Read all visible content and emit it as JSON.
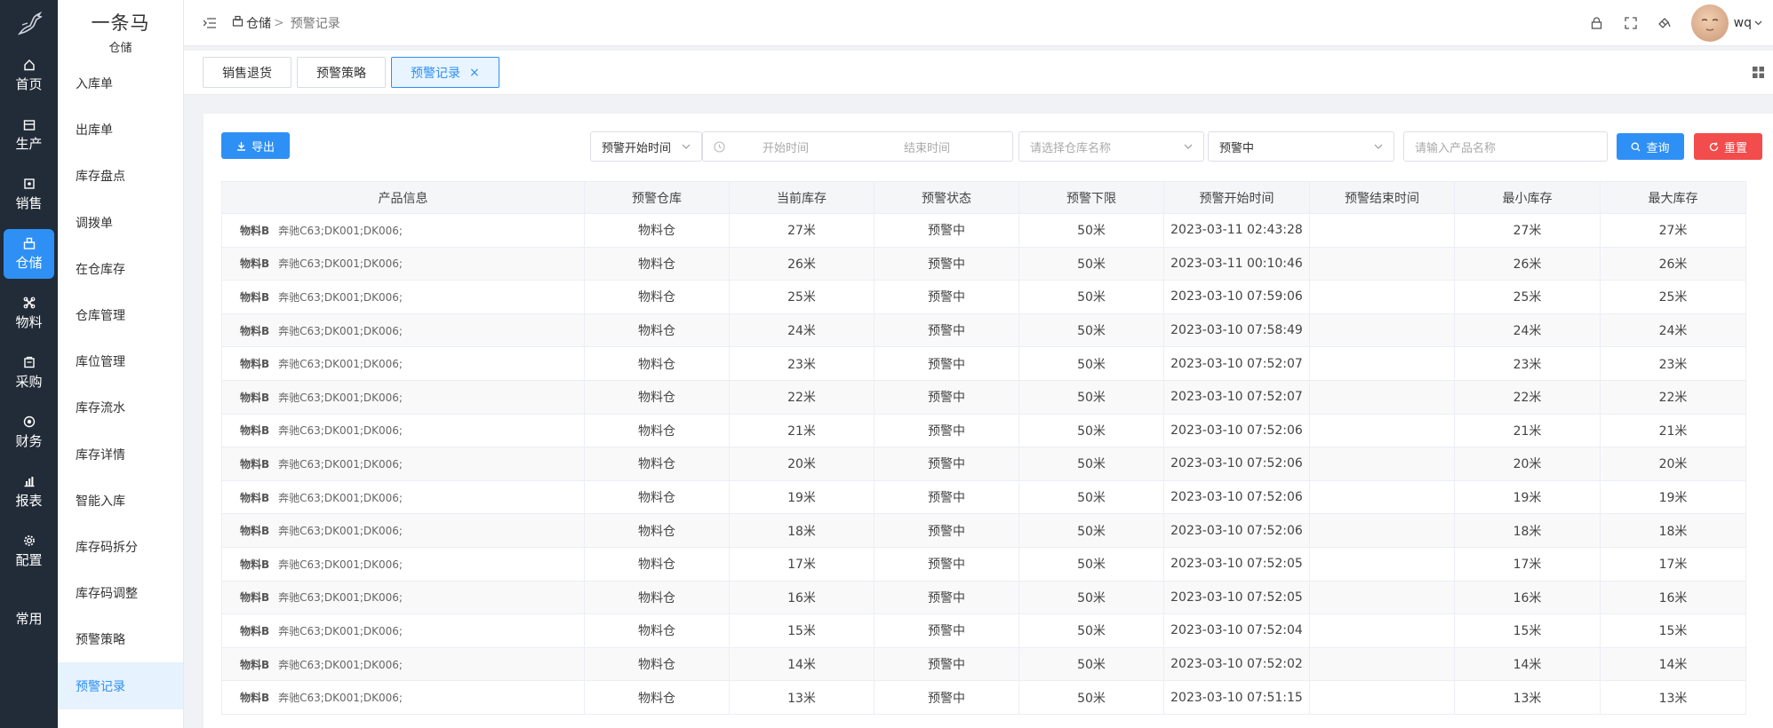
{
  "rail": {
    "items": [
      {
        "label": "首页",
        "icon": "home-icon"
      },
      {
        "label": "生产",
        "icon": "production-icon"
      },
      {
        "label": "销售",
        "icon": "sales-icon"
      },
      {
        "label": "仓储",
        "icon": "warehouse-icon",
        "active": true
      },
      {
        "label": "物料",
        "icon": "material-icon"
      },
      {
        "label": "采购",
        "icon": "purchase-icon"
      },
      {
        "label": "财务",
        "icon": "finance-icon"
      },
      {
        "label": "报表",
        "icon": "report-icon"
      },
      {
        "label": "配置",
        "icon": "gear-icon"
      },
      {
        "label": "常用",
        "icon": ""
      }
    ]
  },
  "brand": {
    "name": "一条马",
    "section": "仓储"
  },
  "sidebar": {
    "items": [
      {
        "label": "入库单"
      },
      {
        "label": "出库单"
      },
      {
        "label": "库存盘点"
      },
      {
        "label": "调拨单"
      },
      {
        "label": "在仓库存"
      },
      {
        "label": "仓库管理"
      },
      {
        "label": "库位管理"
      },
      {
        "label": "库存流水"
      },
      {
        "label": "库存详情"
      },
      {
        "label": "智能入库"
      },
      {
        "label": "库存码拆分"
      },
      {
        "label": "库存码调整"
      },
      {
        "label": "预警策略"
      },
      {
        "label": "预警记录",
        "active": true
      }
    ]
  },
  "header": {
    "breadcrumb_root": "仓储",
    "breadcrumb_sep": ">",
    "breadcrumb_current": "预警记录",
    "username": "wq"
  },
  "tabs": [
    {
      "label": "销售退货"
    },
    {
      "label": "预警策略"
    },
    {
      "label": "预警记录",
      "active": true,
      "close": "×"
    }
  ],
  "toolbar": {
    "export_label": "导出",
    "time_type": "预警开始时间",
    "start_placeholder": "开始时间",
    "end_placeholder": "结束时间",
    "warehouse_placeholder": "请选择仓库名称",
    "status_value": "预警中",
    "product_placeholder": "请输入产品名称",
    "query_label": "查询",
    "reset_label": "重置"
  },
  "table": {
    "columns": [
      "产品信息",
      "预警仓库",
      "当前库存",
      "预警状态",
      "预警下限",
      "预警开始时间",
      "预警结束时间",
      "最小库存",
      "最大库存"
    ],
    "rows": [
      {
        "name": "物料B",
        "spec": "奔驰C63;DK001;DK006;",
        "warehouse": "物料仓",
        "current": "27米",
        "status": "预警中",
        "lower": "50米",
        "start": "2023-03-11 02:43:28",
        "end": "",
        "min": "27米",
        "max": "27米"
      },
      {
        "name": "物料B",
        "spec": "奔驰C63;DK001;DK006;",
        "warehouse": "物料仓",
        "current": "26米",
        "status": "预警中",
        "lower": "50米",
        "start": "2023-03-11 00:10:46",
        "end": "",
        "min": "26米",
        "max": "26米"
      },
      {
        "name": "物料B",
        "spec": "奔驰C63;DK001;DK006;",
        "warehouse": "物料仓",
        "current": "25米",
        "status": "预警中",
        "lower": "50米",
        "start": "2023-03-10 07:59:06",
        "end": "",
        "min": "25米",
        "max": "25米"
      },
      {
        "name": "物料B",
        "spec": "奔驰C63;DK001;DK006;",
        "warehouse": "物料仓",
        "current": "24米",
        "status": "预警中",
        "lower": "50米",
        "start": "2023-03-10 07:58:49",
        "end": "",
        "min": "24米",
        "max": "24米"
      },
      {
        "name": "物料B",
        "spec": "奔驰C63;DK001;DK006;",
        "warehouse": "物料仓",
        "current": "23米",
        "status": "预警中",
        "lower": "50米",
        "start": "2023-03-10 07:52:07",
        "end": "",
        "min": "23米",
        "max": "23米"
      },
      {
        "name": "物料B",
        "spec": "奔驰C63;DK001;DK006;",
        "warehouse": "物料仓",
        "current": "22米",
        "status": "预警中",
        "lower": "50米",
        "start": "2023-03-10 07:52:07",
        "end": "",
        "min": "22米",
        "max": "22米"
      },
      {
        "name": "物料B",
        "spec": "奔驰C63;DK001;DK006;",
        "warehouse": "物料仓",
        "current": "21米",
        "status": "预警中",
        "lower": "50米",
        "start": "2023-03-10 07:52:06",
        "end": "",
        "min": "21米",
        "max": "21米"
      },
      {
        "name": "物料B",
        "spec": "奔驰C63;DK001;DK006;",
        "warehouse": "物料仓",
        "current": "20米",
        "status": "预警中",
        "lower": "50米",
        "start": "2023-03-10 07:52:06",
        "end": "",
        "min": "20米",
        "max": "20米"
      },
      {
        "name": "物料B",
        "spec": "奔驰C63;DK001;DK006;",
        "warehouse": "物料仓",
        "current": "19米",
        "status": "预警中",
        "lower": "50米",
        "start": "2023-03-10 07:52:06",
        "end": "",
        "min": "19米",
        "max": "19米"
      },
      {
        "name": "物料B",
        "spec": "奔驰C63;DK001;DK006;",
        "warehouse": "物料仓",
        "current": "18米",
        "status": "预警中",
        "lower": "50米",
        "start": "2023-03-10 07:52:06",
        "end": "",
        "min": "18米",
        "max": "18米"
      },
      {
        "name": "物料B",
        "spec": "奔驰C63;DK001;DK006;",
        "warehouse": "物料仓",
        "current": "17米",
        "status": "预警中",
        "lower": "50米",
        "start": "2023-03-10 07:52:05",
        "end": "",
        "min": "17米",
        "max": "17米"
      },
      {
        "name": "物料B",
        "spec": "奔驰C63;DK001;DK006;",
        "warehouse": "物料仓",
        "current": "16米",
        "status": "预警中",
        "lower": "50米",
        "start": "2023-03-10 07:52:05",
        "end": "",
        "min": "16米",
        "max": "16米"
      },
      {
        "name": "物料B",
        "spec": "奔驰C63;DK001;DK006;",
        "warehouse": "物料仓",
        "current": "15米",
        "status": "预警中",
        "lower": "50米",
        "start": "2023-03-10 07:52:04",
        "end": "",
        "min": "15米",
        "max": "15米"
      },
      {
        "name": "物料B",
        "spec": "奔驰C63;DK001;DK006;",
        "warehouse": "物料仓",
        "current": "14米",
        "status": "预警中",
        "lower": "50米",
        "start": "2023-03-10 07:52:02",
        "end": "",
        "min": "14米",
        "max": "14米"
      },
      {
        "name": "物料B",
        "spec": "奔驰C63;DK001;DK006;",
        "warehouse": "物料仓",
        "current": "13米",
        "status": "预警中",
        "lower": "50米",
        "start": "2023-03-10 07:51:15",
        "end": "",
        "min": "13米",
        "max": "13米"
      }
    ]
  },
  "colors": {
    "primary": "#2e90f5",
    "danger": "#f24c4c",
    "rail_bg": "#222c38"
  }
}
